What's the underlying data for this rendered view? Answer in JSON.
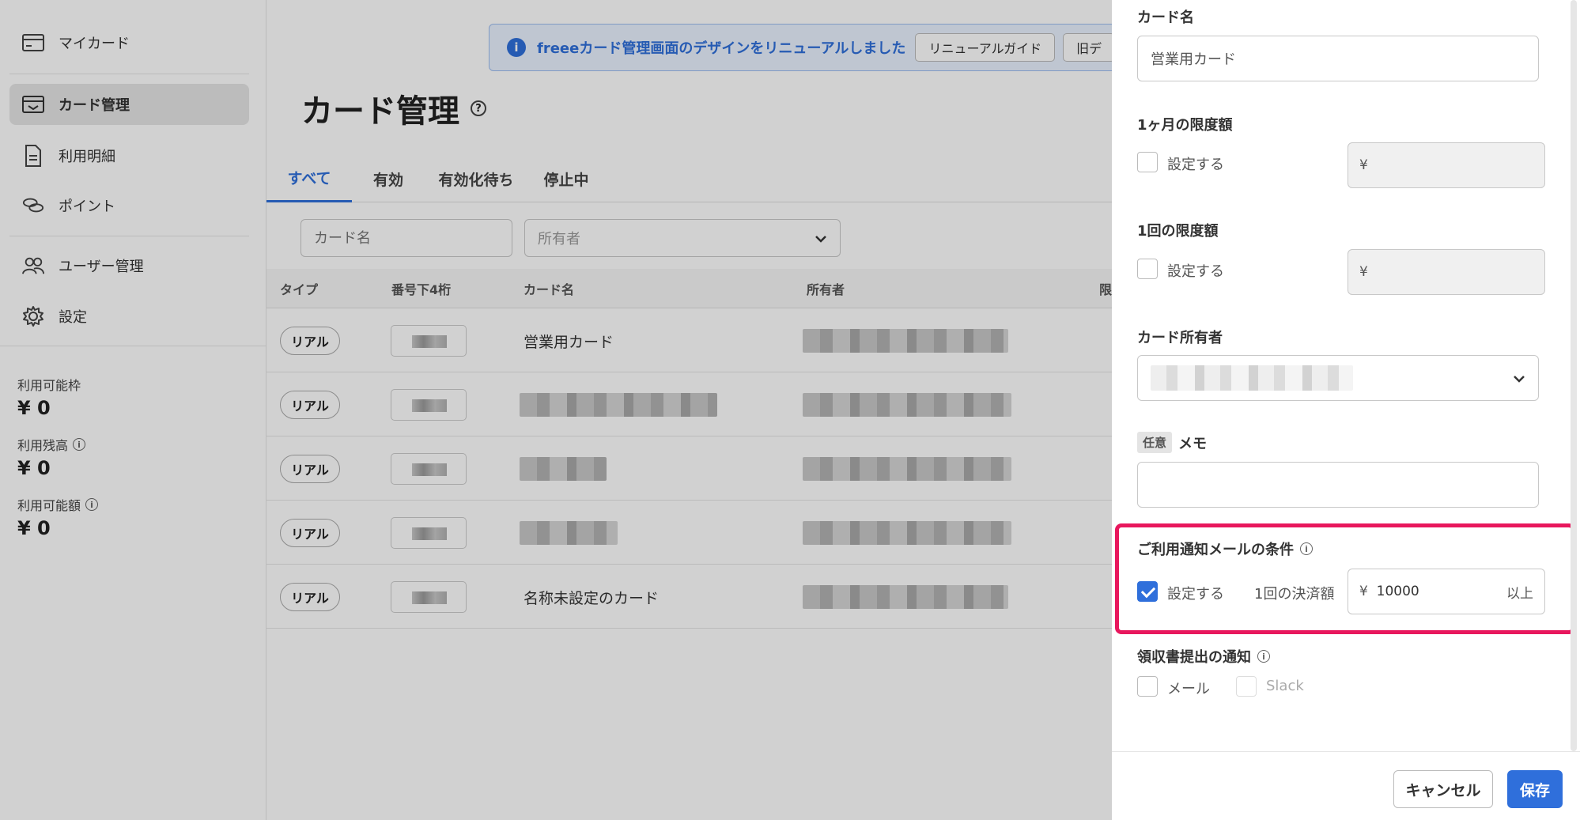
{
  "sidebar": {
    "items": [
      {
        "label": "マイカード",
        "icon": "card-icon"
      },
      {
        "label": "カード管理",
        "icon": "card-manage-icon",
        "active": true
      },
      {
        "label": "利用明細",
        "icon": "document-icon"
      },
      {
        "label": "ポイント",
        "icon": "coins-icon"
      },
      {
        "label": "ユーザー管理",
        "icon": "users-icon"
      },
      {
        "label": "設定",
        "icon": "gear-icon"
      }
    ],
    "stats": [
      {
        "label": "利用可能枠",
        "value": "¥ 0",
        "info": false
      },
      {
        "label": "利用残高",
        "value": "¥ 0",
        "info": true
      },
      {
        "label": "利用可能額",
        "value": "¥ 0",
        "info": true
      }
    ]
  },
  "banner": {
    "text": "freeeカード管理画面のデザインをリニューアルしました",
    "guide_button": "リニューアルガイド",
    "old_button": "旧デ"
  },
  "page": {
    "title": "カード管理",
    "tabs": [
      "すべて",
      "有効",
      "有効化待ち",
      "停止中"
    ],
    "filters": {
      "card_name_placeholder": "カード名",
      "owner_placeholder": "所有者"
    },
    "columns": [
      "タイプ",
      "番号下4桁",
      "カード名",
      "所有者",
      "限"
    ],
    "rows": [
      {
        "type": "リアル",
        "card_name": "営業用カード"
      },
      {
        "type": "リアル",
        "card_name": ""
      },
      {
        "type": "リアル",
        "card_name": ""
      },
      {
        "type": "リアル",
        "card_name": ""
      },
      {
        "type": "リアル",
        "card_name": "名称未設定のカード"
      }
    ]
  },
  "drawer": {
    "card_name_label": "カード名",
    "card_name_value": "営業用カード",
    "monthly_limit_label": "1ヶ月の限度額",
    "monthly_limit_check": "設定する",
    "single_limit_label": "1回の限度額",
    "single_limit_check": "設定する",
    "yen": "¥",
    "owner_label": "カード所有者",
    "memo_optional": "任意",
    "memo_label": "メモ",
    "notify_label": "ご利用通知メールの条件",
    "notify_check": "設定する",
    "notify_per_payment": "1回の決済額",
    "notify_amount": "10000",
    "notify_suffix": "以上",
    "receipt_label": "領収書提出の通知",
    "receipt_mail": "メール",
    "receipt_slack": "Slack",
    "cancel_button": "キャンセル",
    "save_button": "保存"
  },
  "colors": {
    "accent": "#2f6fdb",
    "highlight": "#e8175d"
  }
}
